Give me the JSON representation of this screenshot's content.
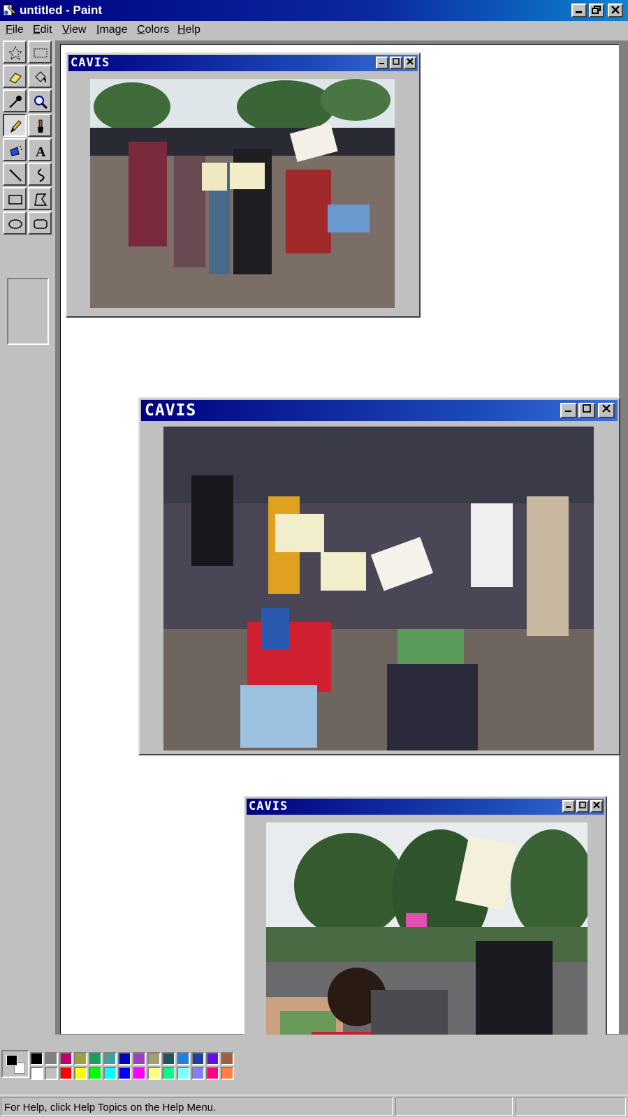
{
  "app": {
    "title": "untitled - Paint"
  },
  "menu": {
    "items": [
      {
        "key": "F",
        "rest": "ile"
      },
      {
        "key": "E",
        "rest": "dit"
      },
      {
        "key": "V",
        "rest": "iew"
      },
      {
        "key": "I",
        "rest": "mage"
      },
      {
        "key": "C",
        "rest": "olors"
      },
      {
        "key": "H",
        "rest": "elp"
      }
    ]
  },
  "tools": [
    "free-form-select-icon",
    "select-icon",
    "eraser-icon",
    "fill-icon",
    "pick-color-icon",
    "magnifier-icon",
    "pencil-icon",
    "brush-icon",
    "airbrush-icon",
    "text-icon",
    "line-icon",
    "curve-icon",
    "rectangle-icon",
    "polygon-icon",
    "ellipse-icon",
    "rounded-rectangle-icon"
  ],
  "active_tool": "pencil-icon",
  "canvas_windows": [
    {
      "title": "CAVIS",
      "photo": "group-protest-photo-1"
    },
    {
      "title": "CAVIS",
      "photo": "group-protest-photo-2"
    },
    {
      "title": "CAVIS",
      "photo": "group-protest-photo-3"
    }
  ],
  "palette": {
    "foreground": "#000000",
    "background": "#ffffff",
    "row1": [
      "#000000",
      "#808080",
      "#c0006c",
      "#a0a040",
      "#18a060",
      "#40a0a0",
      "#0000c0",
      "#a040c0",
      "#a0a070",
      "#205858",
      "#2080e0",
      "#2040a0",
      "#6010e0",
      "#a06040"
    ],
    "row2": [
      "#ffffff",
      "#c0c0c0",
      "#ff0000",
      "#ffff00",
      "#00ff00",
      "#00ffff",
      "#0000ff",
      "#ff00ff",
      "#ffff80",
      "#00ff80",
      "#80ffff",
      "#8080ff",
      "#ff0080",
      "#ff8040"
    ]
  },
  "status": {
    "help_text": "For Help, click Help Topics on the Help Menu."
  }
}
